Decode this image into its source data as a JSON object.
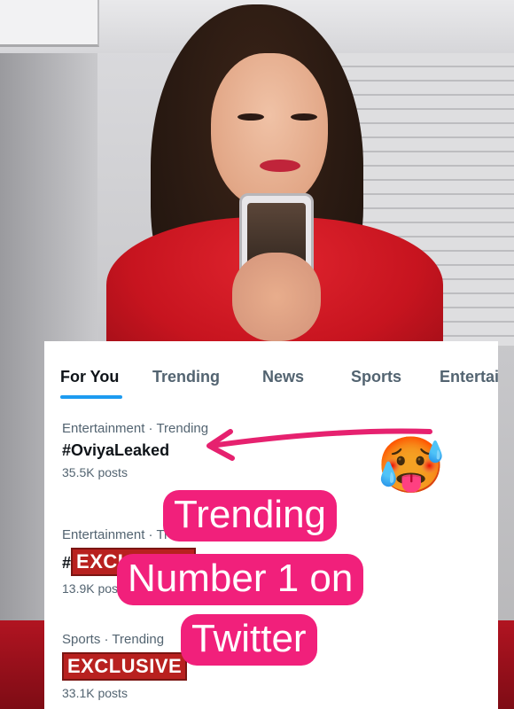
{
  "tabs": [
    "For You",
    "Trending",
    "News",
    "Sports",
    "Entertainment"
  ],
  "trends": [
    {
      "meta": "Entertainment · Trending",
      "tag": "#OviyaLeaked",
      "posts": "35.5K posts"
    },
    {
      "meta": "Entertainment · Trending",
      "tag_prefix": "#",
      "badge": "EXCLUSIVE",
      "posts": "13.9K posts"
    },
    {
      "meta": "Sports · Trending",
      "badge": "EXCLUSIVE",
      "posts": "33.1K posts"
    }
  ],
  "caption": [
    "Trending",
    "Number 1 on",
    "Twitter"
  ],
  "emoji": "🥵",
  "colors": {
    "caption_bg": "#f1207b",
    "arrow": "#e6216f",
    "tab_underline": "#1d9bf0",
    "badge": "#b8211f"
  }
}
